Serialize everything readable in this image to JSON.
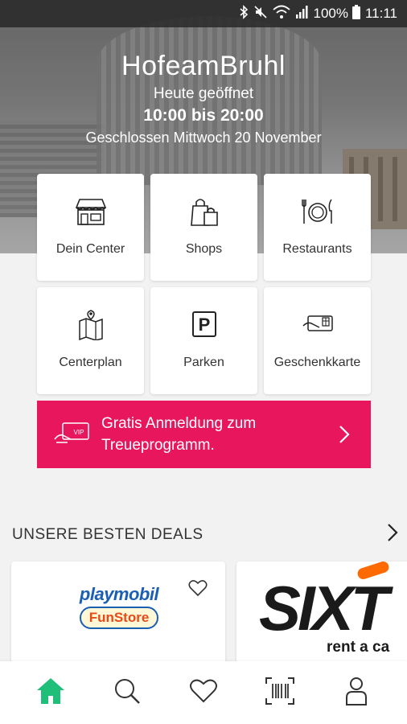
{
  "status_bar": {
    "battery": "100%",
    "time": "11:11",
    "icons": [
      "bluetooth-icon",
      "mute-icon",
      "wifi-icon",
      "signal-icon",
      "battery-icon"
    ]
  },
  "header": {
    "center_name": "HofeamBruhl",
    "open_status": "Heute geöffnet",
    "hours": "10:00 bis 20:00",
    "closed_note": "Geschlossen Mittwoch 20 November"
  },
  "tiles": [
    {
      "label": "Dein Center",
      "icon": "storefront-icon"
    },
    {
      "label": "Shops",
      "icon": "shopping-bags-icon"
    },
    {
      "label": "Restaurants",
      "icon": "plate-cutlery-icon"
    },
    {
      "label": "Centerplan",
      "icon": "map-pin-icon"
    },
    {
      "label": "Parken",
      "icon": "parking-icon"
    },
    {
      "label": "Geschenkkarte",
      "icon": "gift-card-icon"
    }
  ],
  "promo": {
    "text": "Gratis Anmeldung zum Treueprogramm.",
    "icon": "vip-card-icon",
    "color": "#e8175d"
  },
  "deals": {
    "title": "UNSERE BESTEN DEALS",
    "items": [
      {
        "brand_top": "playmobil",
        "brand_bottom": "FunStore"
      },
      {
        "brand_top": "SIXT",
        "brand_bottom": "rent a ca"
      }
    ]
  },
  "bottom_nav": [
    {
      "icon": "home-icon",
      "active": true
    },
    {
      "icon": "search-icon",
      "active": false
    },
    {
      "icon": "heart-icon",
      "active": false
    },
    {
      "icon": "barcode-icon",
      "active": false
    },
    {
      "icon": "user-icon",
      "active": false
    }
  ],
  "colors": {
    "accent_pink": "#e8175d",
    "active_nav_green": "#1fbf7a"
  }
}
